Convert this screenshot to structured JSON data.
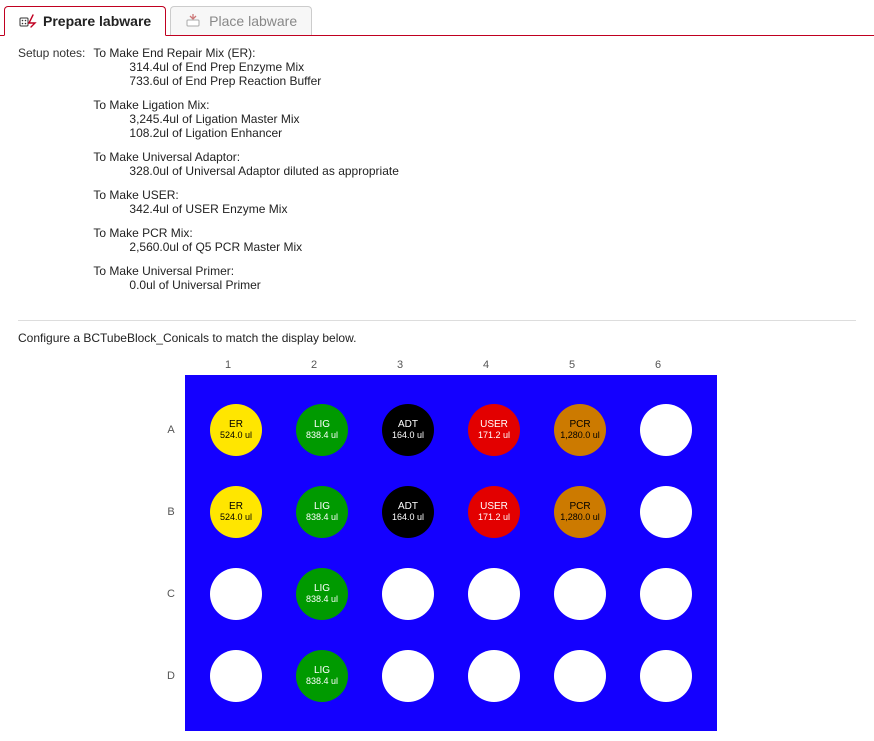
{
  "tabs": [
    {
      "label": "Prepare labware",
      "active": true
    },
    {
      "label": "Place labware",
      "active": false
    }
  ],
  "setup_label": "Setup notes:",
  "setup_groups": [
    {
      "title": "To Make End Repair Mix (ER):",
      "lines": [
        "314.4ul of End Prep Enzyme Mix",
        "733.6ul of End Prep Reaction Buffer"
      ]
    },
    {
      "title": "To Make Ligation Mix:",
      "lines": [
        "3,245.4ul of Ligation Master Mix",
        "108.2ul of  Ligation Enhancer"
      ]
    },
    {
      "title": "To Make Universal Adaptor:",
      "lines": [
        "328.0ul of Universal Adaptor diluted as appropriate"
      ]
    },
    {
      "title": "To Make USER:",
      "lines": [
        "342.4ul of USER Enzyme Mix"
      ]
    },
    {
      "title": "To Make PCR Mix:",
      "lines": [
        "2,560.0ul of Q5 PCR Master Mix"
      ]
    },
    {
      "title": "To Make Universal Primer:",
      "lines": [
        "0.0ul of Universal Primer"
      ]
    }
  ],
  "configure_instruction": "Configure a BCTubeBlock_Conicals to match the display below.",
  "block": {
    "cols": [
      "1",
      "2",
      "3",
      "4",
      "5",
      "6"
    ],
    "rows": [
      "A",
      "B",
      "C",
      "D"
    ],
    "wells": {
      "A1": {
        "label": "ER",
        "vol": "524.0 ul",
        "bg": "#ffe600",
        "fg": "#000000"
      },
      "A2": {
        "label": "LIG",
        "vol": "838.4 ul",
        "bg": "#009a00",
        "fg": "#ffffff"
      },
      "A3": {
        "label": "ADT",
        "vol": "164.0 ul",
        "bg": "#000000",
        "fg": "#ffffff"
      },
      "A4": {
        "label": "USER",
        "vol": "171.2 ul",
        "bg": "#e30000",
        "fg": "#ffffff"
      },
      "A5": {
        "label": "PCR",
        "vol": "1,280.0 ul",
        "bg": "#cc7a00",
        "fg": "#000000"
      },
      "A6": null,
      "B1": {
        "label": "ER",
        "vol": "524.0 ul",
        "bg": "#ffe600",
        "fg": "#000000"
      },
      "B2": {
        "label": "LIG",
        "vol": "838.4 ul",
        "bg": "#009a00",
        "fg": "#ffffff"
      },
      "B3": {
        "label": "ADT",
        "vol": "164.0 ul",
        "bg": "#000000",
        "fg": "#ffffff"
      },
      "B4": {
        "label": "USER",
        "vol": "171.2 ul",
        "bg": "#e30000",
        "fg": "#ffffff"
      },
      "B5": {
        "label": "PCR",
        "vol": "1,280.0 ul",
        "bg": "#cc7a00",
        "fg": "#000000"
      },
      "B6": null,
      "C1": null,
      "C2": {
        "label": "LIG",
        "vol": "838.4 ul",
        "bg": "#009a00",
        "fg": "#ffffff"
      },
      "C3": null,
      "C4": null,
      "C5": null,
      "C6": null,
      "D1": null,
      "D2": {
        "label": "LIG",
        "vol": "838.4 ul",
        "bg": "#009a00",
        "fg": "#ffffff"
      },
      "D3": null,
      "D4": null,
      "D5": null,
      "D6": null
    }
  }
}
